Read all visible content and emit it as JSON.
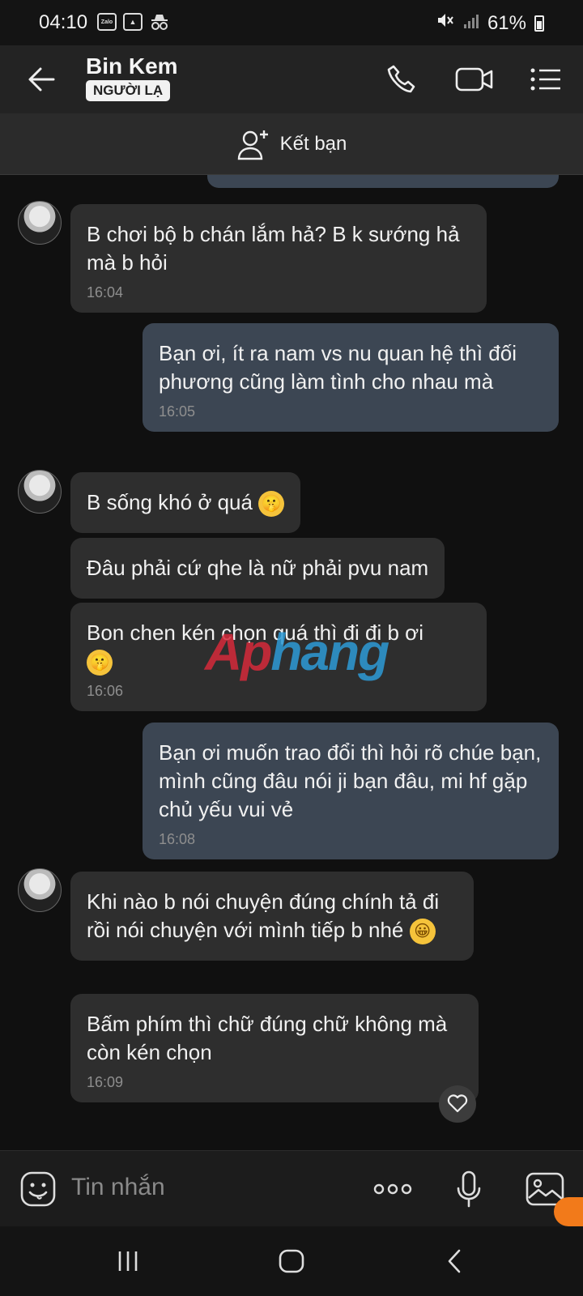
{
  "status": {
    "time": "04:10",
    "app_badge": "Zalo",
    "battery": "61%"
  },
  "header": {
    "name": "Bin Kem",
    "badge": "NGƯỜI LẠ"
  },
  "friend_bar": {
    "label": "Kết bạn"
  },
  "messages": [
    {
      "side": "in",
      "text": "B chơi bộ b chán lắm hả? B k sướng hả mà b hỏi",
      "time": "16:04"
    },
    {
      "side": "out",
      "text": "Bạn ơi, ít ra nam vs nu quan hệ thì đối phương cũng làm tình cho nhau mà",
      "time": "16:05"
    },
    {
      "side": "in",
      "text": "B sống khó ở quá",
      "emoji": "shushing-face",
      "time": ""
    },
    {
      "side": "in",
      "text": "Đâu phải cứ qhe là nữ phải pvu nam",
      "time": ""
    },
    {
      "side": "in",
      "text": "Bon chen kén chọn quá thì đi đi b ơi",
      "emoji": "shushing-face",
      "time": "16:06"
    },
    {
      "side": "out",
      "text": "Bạn ơi muốn trao đổi thì hỏi rõ chúe bạn, mình cũng đâu nói ji bạn đâu, mi hf gặp chủ yếu vui vẻ",
      "time": "16:08"
    },
    {
      "side": "in",
      "text": "Khi nào b nói chuyện đúng chính tả đi rồi nói chuyện với mình tiếp b nhé",
      "emoji": "grinning-face",
      "time": ""
    },
    {
      "side": "in",
      "text": "Bấm phím thì chữ đúng chữ không mà còn kén chọn",
      "time": "16:09"
    }
  ],
  "watermark": {
    "part1": "Ap",
    "part2": "hang"
  },
  "input": {
    "placeholder": "Tin nhắn"
  },
  "colors": {
    "incoming_bubble": "#2e2e2e",
    "outgoing_bubble": "#3c4653",
    "background": "#101010"
  }
}
